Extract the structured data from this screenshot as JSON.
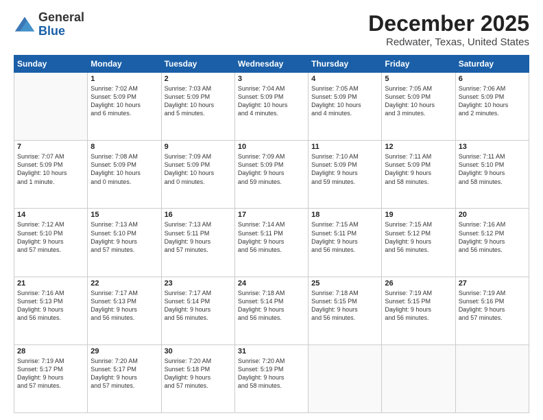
{
  "header": {
    "logo_line1": "General",
    "logo_line2": "Blue",
    "title": "December 2025",
    "subtitle": "Redwater, Texas, United States"
  },
  "columns": [
    "Sunday",
    "Monday",
    "Tuesday",
    "Wednesday",
    "Thursday",
    "Friday",
    "Saturday"
  ],
  "rows": [
    [
      {
        "day": "",
        "info": ""
      },
      {
        "day": "1",
        "info": "Sunrise: 7:02 AM\nSunset: 5:09 PM\nDaylight: 10 hours\nand 6 minutes."
      },
      {
        "day": "2",
        "info": "Sunrise: 7:03 AM\nSunset: 5:09 PM\nDaylight: 10 hours\nand 5 minutes."
      },
      {
        "day": "3",
        "info": "Sunrise: 7:04 AM\nSunset: 5:09 PM\nDaylight: 10 hours\nand 4 minutes."
      },
      {
        "day": "4",
        "info": "Sunrise: 7:05 AM\nSunset: 5:09 PM\nDaylight: 10 hours\nand 4 minutes."
      },
      {
        "day": "5",
        "info": "Sunrise: 7:05 AM\nSunset: 5:09 PM\nDaylight: 10 hours\nand 3 minutes."
      },
      {
        "day": "6",
        "info": "Sunrise: 7:06 AM\nSunset: 5:09 PM\nDaylight: 10 hours\nand 2 minutes."
      }
    ],
    [
      {
        "day": "7",
        "info": "Sunrise: 7:07 AM\nSunset: 5:09 PM\nDaylight: 10 hours\nand 1 minute."
      },
      {
        "day": "8",
        "info": "Sunrise: 7:08 AM\nSunset: 5:09 PM\nDaylight: 10 hours\nand 0 minutes."
      },
      {
        "day": "9",
        "info": "Sunrise: 7:09 AM\nSunset: 5:09 PM\nDaylight: 10 hours\nand 0 minutes."
      },
      {
        "day": "10",
        "info": "Sunrise: 7:09 AM\nSunset: 5:09 PM\nDaylight: 9 hours\nand 59 minutes."
      },
      {
        "day": "11",
        "info": "Sunrise: 7:10 AM\nSunset: 5:09 PM\nDaylight: 9 hours\nand 59 minutes."
      },
      {
        "day": "12",
        "info": "Sunrise: 7:11 AM\nSunset: 5:09 PM\nDaylight: 9 hours\nand 58 minutes."
      },
      {
        "day": "13",
        "info": "Sunrise: 7:11 AM\nSunset: 5:10 PM\nDaylight: 9 hours\nand 58 minutes."
      }
    ],
    [
      {
        "day": "14",
        "info": "Sunrise: 7:12 AM\nSunset: 5:10 PM\nDaylight: 9 hours\nand 57 minutes."
      },
      {
        "day": "15",
        "info": "Sunrise: 7:13 AM\nSunset: 5:10 PM\nDaylight: 9 hours\nand 57 minutes."
      },
      {
        "day": "16",
        "info": "Sunrise: 7:13 AM\nSunset: 5:11 PM\nDaylight: 9 hours\nand 57 minutes."
      },
      {
        "day": "17",
        "info": "Sunrise: 7:14 AM\nSunset: 5:11 PM\nDaylight: 9 hours\nand 56 minutes."
      },
      {
        "day": "18",
        "info": "Sunrise: 7:15 AM\nSunset: 5:11 PM\nDaylight: 9 hours\nand 56 minutes."
      },
      {
        "day": "19",
        "info": "Sunrise: 7:15 AM\nSunset: 5:12 PM\nDaylight: 9 hours\nand 56 minutes."
      },
      {
        "day": "20",
        "info": "Sunrise: 7:16 AM\nSunset: 5:12 PM\nDaylight: 9 hours\nand 56 minutes."
      }
    ],
    [
      {
        "day": "21",
        "info": "Sunrise: 7:16 AM\nSunset: 5:13 PM\nDaylight: 9 hours\nand 56 minutes."
      },
      {
        "day": "22",
        "info": "Sunrise: 7:17 AM\nSunset: 5:13 PM\nDaylight: 9 hours\nand 56 minutes."
      },
      {
        "day": "23",
        "info": "Sunrise: 7:17 AM\nSunset: 5:14 PM\nDaylight: 9 hours\nand 56 minutes."
      },
      {
        "day": "24",
        "info": "Sunrise: 7:18 AM\nSunset: 5:14 PM\nDaylight: 9 hours\nand 56 minutes."
      },
      {
        "day": "25",
        "info": "Sunrise: 7:18 AM\nSunset: 5:15 PM\nDaylight: 9 hours\nand 56 minutes."
      },
      {
        "day": "26",
        "info": "Sunrise: 7:19 AM\nSunset: 5:15 PM\nDaylight: 9 hours\nand 56 minutes."
      },
      {
        "day": "27",
        "info": "Sunrise: 7:19 AM\nSunset: 5:16 PM\nDaylight: 9 hours\nand 57 minutes."
      }
    ],
    [
      {
        "day": "28",
        "info": "Sunrise: 7:19 AM\nSunset: 5:17 PM\nDaylight: 9 hours\nand 57 minutes."
      },
      {
        "day": "29",
        "info": "Sunrise: 7:20 AM\nSunset: 5:17 PM\nDaylight: 9 hours\nand 57 minutes."
      },
      {
        "day": "30",
        "info": "Sunrise: 7:20 AM\nSunset: 5:18 PM\nDaylight: 9 hours\nand 57 minutes."
      },
      {
        "day": "31",
        "info": "Sunrise: 7:20 AM\nSunset: 5:19 PM\nDaylight: 9 hours\nand 58 minutes."
      },
      {
        "day": "",
        "info": ""
      },
      {
        "day": "",
        "info": ""
      },
      {
        "day": "",
        "info": ""
      }
    ]
  ]
}
